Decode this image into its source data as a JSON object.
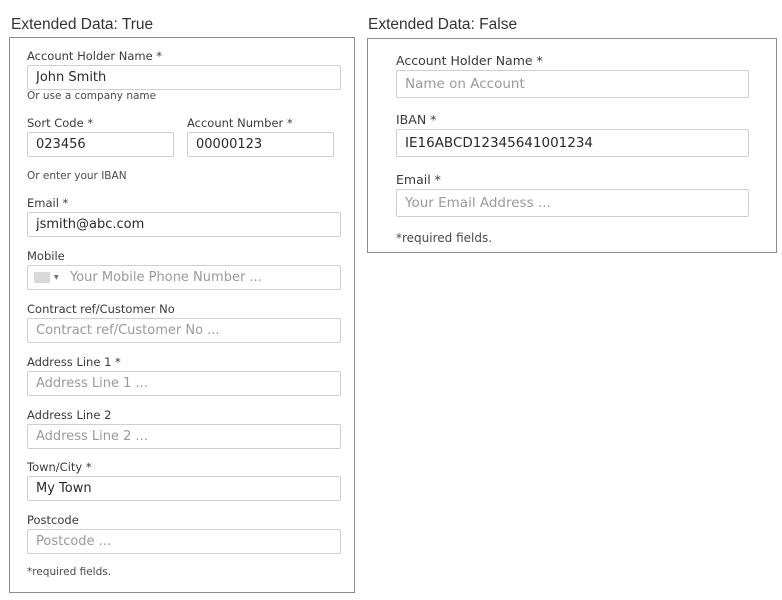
{
  "left_panel": {
    "title": "Extended Data: True",
    "account_holder": {
      "label": "Account Holder Name *",
      "value": "John Smith",
      "placeholder": ""
    },
    "company_hint": "Or use a company name",
    "sort_code": {
      "label": "Sort Code *",
      "value": "023456"
    },
    "account_number": {
      "label": "Account Number *",
      "value": "00000123"
    },
    "iban_hint": "Or enter your IBAN",
    "email": {
      "label": "Email *",
      "value": "jsmith@abc.com"
    },
    "mobile": {
      "label": "Mobile",
      "placeholder": "Your Mobile Phone Number ..."
    },
    "contract_ref": {
      "label": "Contract ref/Customer No",
      "placeholder": "Contract ref/Customer No ..."
    },
    "address1": {
      "label": "Address Line 1 *",
      "placeholder": "Address Line 1 ..."
    },
    "address2": {
      "label": "Address Line 2",
      "placeholder": "Address Line 2 ..."
    },
    "town": {
      "label": "Town/City *",
      "value": "My Town"
    },
    "postcode": {
      "label": "Postcode",
      "placeholder": "Postcode ..."
    },
    "required_note": "*required fields."
  },
  "right_panel": {
    "title": "Extended Data: False",
    "account_holder": {
      "label": "Account Holder Name *",
      "placeholder": "Name on Account"
    },
    "iban": {
      "label": "IBAN *",
      "value": "IE16ABCD12345641001234"
    },
    "email": {
      "label": "Email *",
      "placeholder": "Your Email Address ..."
    },
    "required_note": "*required fields."
  }
}
